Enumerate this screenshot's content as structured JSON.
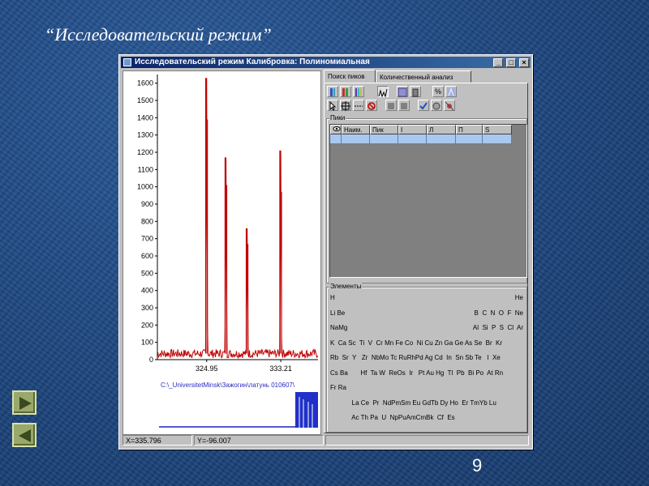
{
  "slide": {
    "title": "“Исследовательский режим”",
    "page_number": "9"
  },
  "window": {
    "title": "Исследовательский режим Калибровка: Полиномиальная",
    "controls": [
      "_",
      "□",
      "×"
    ]
  },
  "chart_data": {
    "type": "line",
    "title": "",
    "xlabel": "",
    "ylabel": "",
    "ylim": [
      0,
      1650
    ],
    "yticks": [
      0,
      100,
      200,
      300,
      400,
      500,
      600,
      700,
      800,
      900,
      1000,
      1100,
      1200,
      1300,
      1400,
      1500,
      1600
    ],
    "xtick_labels": [
      "324.95",
      "333.21"
    ],
    "series": [
      {
        "color": "#c00000",
        "peaks": [
          {
            "x": 324.75,
            "height": 1630,
            "inner": 1390
          },
          {
            "x": 327.4,
            "height": 1170,
            "inner": 1010
          },
          {
            "x": 330.3,
            "height": 760,
            "inner": 670
          },
          {
            "x": 334.9,
            "height": 1210,
            "inner": 970
          }
        ],
        "baseline": 35,
        "x_range": [
          318.0,
          340.0
        ]
      }
    ],
    "grid": true
  },
  "chart": {
    "file_path": "C:\\_UniversitetMinsk\\Зажогин\\латунь 010607\\"
  },
  "status": {
    "x": "X=335.796",
    "y": "Y=-96.007"
  },
  "tabs": [
    {
      "label": "Поиск пиков",
      "active": true
    },
    {
      "label": "Количественный анализ",
      "active": false
    }
  ],
  "peaks_group": {
    "label": "Пики",
    "columns": [
      "👁",
      "Наим.",
      "Пик",
      "I",
      "Л",
      "П",
      "S"
    ]
  },
  "elements_group": {
    "label": "Элементы",
    "rows": [
      {
        "left": "H",
        "right": "He"
      },
      {
        "left": "Li Be",
        "right": "B  C  N  O  F  Ne"
      },
      {
        "left": "NaMg",
        "right": "Al  Si  P  S  Cl  Ar"
      },
      {
        "left": "K  Ca Sc  Ti  V  Cr Mn Fe Co  Ni Cu Zn Ga Ge As Se  Br  Kr",
        "right": ""
      },
      {
        "left": "Rb  Sr  Y   Zr  NbMo Tc RuRhPd Ag Cd  In  Sn Sb Te   I  Xe",
        "right": ""
      },
      {
        "left": "Cs Ba       Hf  Ta W  ReOs  Ir   Pt Au Hg  Tl  Pb  Bi Po  At Rn",
        "right": ""
      },
      {
        "left": "Fr Ra",
        "right": ""
      },
      {
        "left": "            La Ce  Pr  NdPmSm Eu GdTb Dy Ho  Er TmYb Lu",
        "right": ""
      },
      {
        "left": "            Ac Th Pa  U  NpPuAmCmBk  Cf  Es",
        "right": ""
      }
    ]
  }
}
